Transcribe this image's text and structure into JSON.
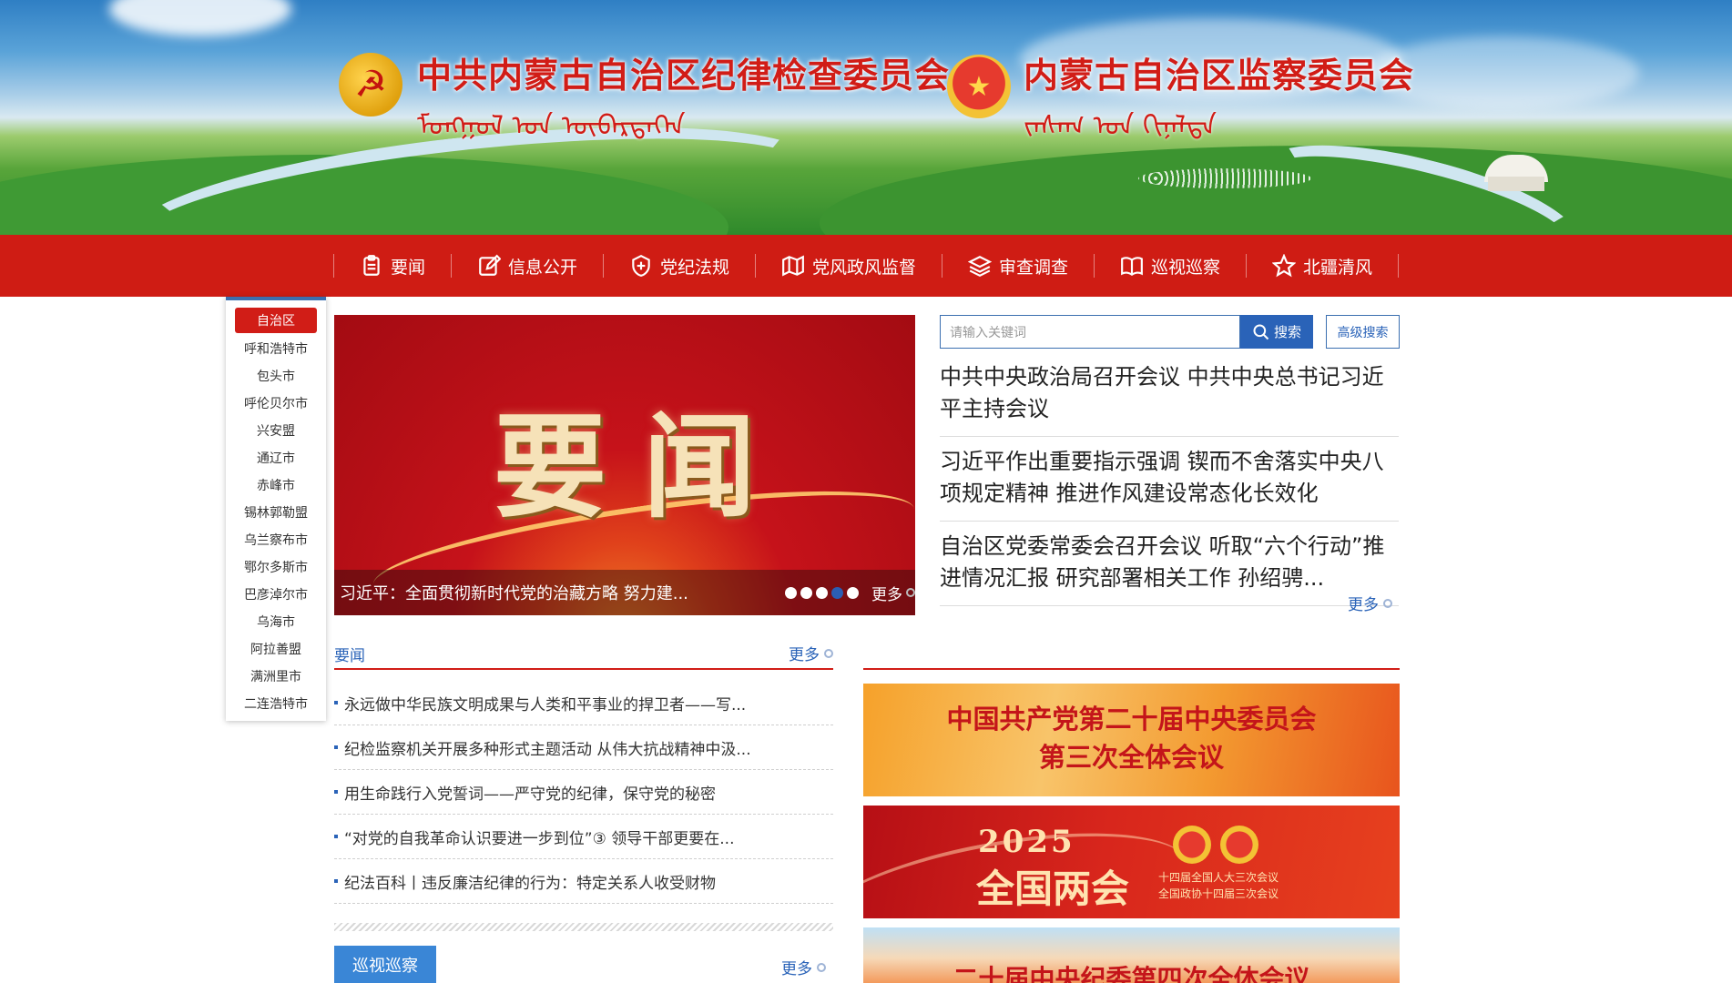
{
  "header": {
    "title_left": "中共内蒙古自治区纪律检查委员会",
    "title_right": "内蒙古自治区监察委员会",
    "mongolian_left": "ᠮᠣᠩᠭᠣᠯ ᠤᠨ ᠥᠪᠡᠷᠲᠡᠭᠡᠨ",
    "mongolian_right": "ᠵᠠᠰᠠᠭ ᠤᠨ ᠬᠢᠨᠠᠯᠲᠠ",
    "party_emblem_icon": "party-emblem-icon",
    "national_emblem_icon": "national-emblem-icon"
  },
  "nav": {
    "items": [
      {
        "label": "要闻",
        "icon": "clipboard-icon"
      },
      {
        "label": "信息公开",
        "icon": "edit-icon"
      },
      {
        "label": "党纪法规",
        "icon": "shield-icon"
      },
      {
        "label": "党风政风监督",
        "icon": "map-icon"
      },
      {
        "label": "审查调查",
        "icon": "layers-icon"
      },
      {
        "label": "巡视巡察",
        "icon": "book-icon"
      },
      {
        "label": "北疆清风",
        "icon": "star-icon"
      }
    ]
  },
  "regions": {
    "items": [
      "自治区",
      "呼和浩特市",
      "包头市",
      "呼伦贝尔市",
      "兴安盟",
      "通辽市",
      "赤峰市",
      "锡林郭勒盟",
      "乌兰察布市",
      "鄂尔多斯市",
      "巴彦淖尔市",
      "乌海市",
      "阿拉善盟",
      "满洲里市",
      "二连浩特市"
    ],
    "active": "自治区"
  },
  "slider": {
    "title": "要闻",
    "caption": "习近平：全面贯彻新时代党的治藏方略 努力建...",
    "active_dot": 4,
    "dot_count": 5,
    "more": "更多"
  },
  "search": {
    "placeholder": "请输入关键词",
    "button": "搜索",
    "advanced": "高级搜索"
  },
  "headlines": {
    "items": [
      "中共中央政治局召开会议 中共中央总书记习近平主持会议",
      "习近平作出重要指示强调 锲而不舍落实中央八项规定精神 推进作风建设常态化长效化",
      "自治区党委常委会召开会议 听取“六个行动”推进情况汇报 研究部署相关工作 孙绍骋..."
    ],
    "more": "更多"
  },
  "news_section": {
    "title": "要闻",
    "more": "更多",
    "items": [
      "永远做中华民族文明成果与人类和平事业的捍卫者——写...",
      "纪检监察机关开展多种形式主题活动 从伟大抗战精神中汲...",
      "用生命践行入党誓词——严守党的纪律，保守党的秘密",
      "“对党的自我革命认识要进一步到位”③ 领导干部更要在...",
      "纪法百科丨违反廉洁纪律的行为：特定关系人收受财物"
    ]
  },
  "inspect_section": {
    "tab": "巡视巡察",
    "more": "更多"
  },
  "promos": {
    "plenum_line1": "中国共产党第二十届中央委员会",
    "plenum_line2": "第三次全体会议",
    "sessions_year": "2025",
    "sessions_name": "全国两会",
    "sessions_sub1": "十四届全国人大三次会议",
    "sessions_sub2": "全国政协十四届三次会议",
    "cdic": "二十届中央纪委第四次全体会议"
  }
}
